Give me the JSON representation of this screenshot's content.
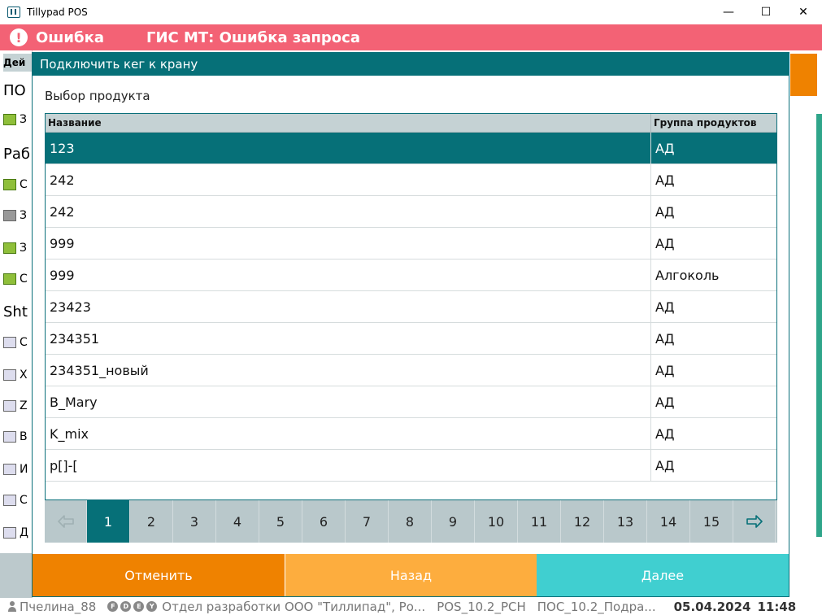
{
  "window": {
    "title": "Tillypad POS",
    "controls": {
      "minimize": "—",
      "maximize": "☐",
      "close": "✕"
    }
  },
  "error": {
    "label": "Ошибка",
    "message": "ГИС МТ: Ошибка запроса"
  },
  "background": {
    "rows": [
      "Дей",
      "ПО",
      "З",
      "Раб",
      "С",
      "З",
      "З",
      "С",
      "Sht",
      "С",
      "Х",
      "Z",
      "В",
      "И",
      "С",
      "Д"
    ]
  },
  "dialog": {
    "title": "Подключить кег к крану",
    "subtitle": "Выбор продукта",
    "columns": {
      "name": "Название",
      "group": "Группа продуктов"
    },
    "rows": [
      {
        "name": "123",
        "group": "АД"
      },
      {
        "name": "242",
        "group": "АД"
      },
      {
        "name": "242",
        "group": "АД"
      },
      {
        "name": "999",
        "group": "АД"
      },
      {
        "name": "999",
        "group": "Алгоколь"
      },
      {
        "name": "23423",
        "group": "АД"
      },
      {
        "name": "234351",
        "group": "АД"
      },
      {
        "name": "234351_новый",
        "group": "АД"
      },
      {
        "name": "B_Mary",
        "group": "АД"
      },
      {
        "name": "K_mix",
        "group": "АД"
      },
      {
        "name": "p[]-[",
        "group": "АД"
      }
    ],
    "selected_row": 0,
    "pager": {
      "pages": [
        "1",
        "2",
        "3",
        "4",
        "5",
        "6",
        "7",
        "8",
        "9",
        "10",
        "11",
        "12",
        "13",
        "14",
        "15"
      ],
      "current": "1",
      "prev_icon": "arrow-left-icon",
      "next_icon": "arrow-right-icon"
    },
    "buttons": {
      "cancel": "Отменить",
      "back": "Назад",
      "next": "Далее"
    }
  },
  "status": {
    "user": "Пчелина_88",
    "badges": [
      "F",
      "D",
      "E",
      "Y"
    ],
    "org": "Отдел разработки ООО \"Тиллипад\", Ро...",
    "terminal": "POS_10.2_PCH",
    "division": "ПОС_10.2_Подра...",
    "date": "05.04.2024",
    "time": "11:48"
  },
  "colors": {
    "accent": "#067078",
    "error": "#f36275",
    "cancel": "#ef8200",
    "back": "#fdad3e",
    "next": "#40cfd0",
    "pager_bg": "#b9c8cb"
  }
}
